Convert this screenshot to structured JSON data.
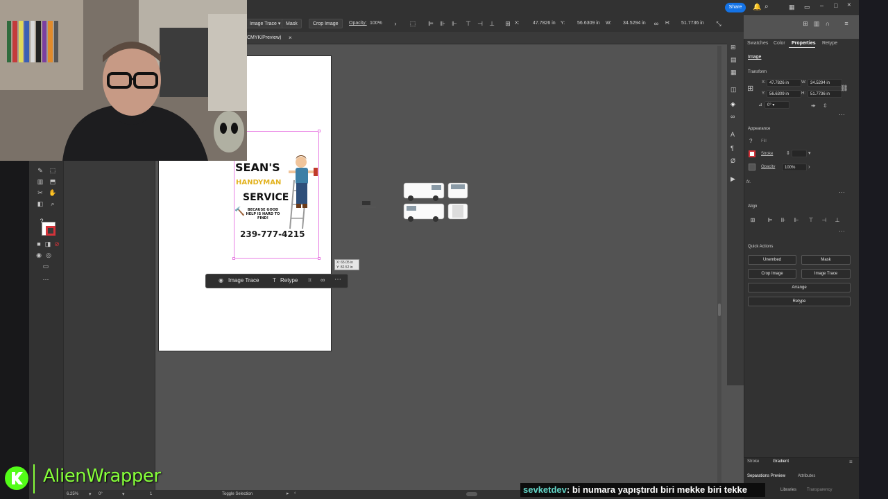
{
  "colors": {
    "accent": "#1473e6",
    "selection": "#e87ee3",
    "brand_green": "#86ff3a",
    "chat_user": "#64d7c9"
  },
  "titlebar": {
    "share_label": "Share"
  },
  "control_bar": {
    "image_trace_label": "Image Trace",
    "mask_label": "Mask",
    "crop_image_label": "Crop Image",
    "opacity_label": "Opacity:",
    "opacity_value": "100%",
    "x_label": "X:",
    "x_value": "47.7826 in",
    "y_label": "Y:",
    "y_value": "56.6309 in",
    "w_label": "W:",
    "w_value": "34.5294 in",
    "h_label": "H:",
    "h_value": "51.7736 in"
  },
  "document_tab": {
    "label": "CMYK/Preview)"
  },
  "flyer": {
    "line1": "SEAN'S",
    "line2": "HANDYMAN",
    "line3": "SERVICE",
    "tagline": "BECAUSE GOOD HELP IS HARD TO FIND!",
    "phone": "239-777-4215"
  },
  "context_bar": {
    "image_trace_label": "Image Trace",
    "retype_label": "Retype"
  },
  "tooltip": {
    "line1": "X: 65.05 in",
    "line2": "Y: 82.52 in"
  },
  "properties_panel": {
    "tabs": [
      "Swatches",
      "Color",
      "Properties",
      "Retype"
    ],
    "active_tab": "Properties",
    "object_type": "Image",
    "transform": {
      "title": "Transform",
      "x_label": "X:",
      "x": "47.7826 in",
      "y_label": "Y:",
      "y": "56.6309 in",
      "w_label": "W:",
      "w": "34.5294 in",
      "h_label": "H:",
      "h": "51.7736 in",
      "angle": "0°"
    },
    "appearance": {
      "title": "Appearance",
      "fill_label": "Fill",
      "stroke_label": "Stroke",
      "opacity_label": "Opacity",
      "opacity_value": "100%",
      "fx_label": "fx."
    },
    "align": {
      "title": "Align"
    },
    "quick_actions": {
      "title": "Quick Actions",
      "unembed": "Unembed",
      "mask": "Mask",
      "crop_image": "Crop Image",
      "image_trace": "Image Trace",
      "arrange": "Arrange",
      "retype": "Retype"
    }
  },
  "bottom_panels": {
    "tabs_row1": [
      "Stroke",
      "Gradient"
    ],
    "tabs_row2": [
      "Separations Preview",
      "Attributes"
    ],
    "tabs_row3": [
      "Libraries",
      "Transparency"
    ]
  },
  "status_bar": {
    "zoom": "6.25%",
    "rotation": "0°",
    "artboard": "1",
    "mode": "Toggle Selection"
  },
  "overlay": {
    "brand": "AlienWrapper",
    "chat_user": "sevketdev",
    "chat_message": ": bi numara yapıştırdı biri mekke biri tekke"
  }
}
